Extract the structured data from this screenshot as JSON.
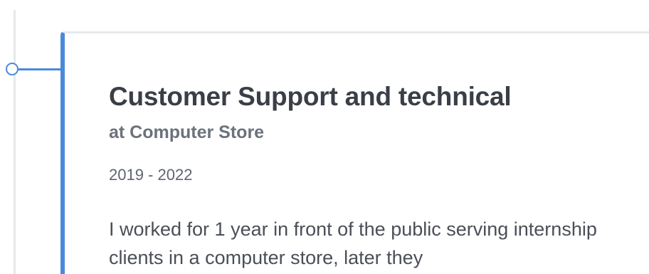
{
  "experience": {
    "title": "Customer Support and technical",
    "company": "at Computer Store",
    "dates": "2019 - 2022",
    "description": "I worked for 1 year in front of the public serving internship clients in a computer store, later they"
  },
  "colors": {
    "accent": "#4a8ad8",
    "timeline_line": "#e6e8ec",
    "title_text": "#3a3f47",
    "subtitle_text": "#6b727c"
  }
}
